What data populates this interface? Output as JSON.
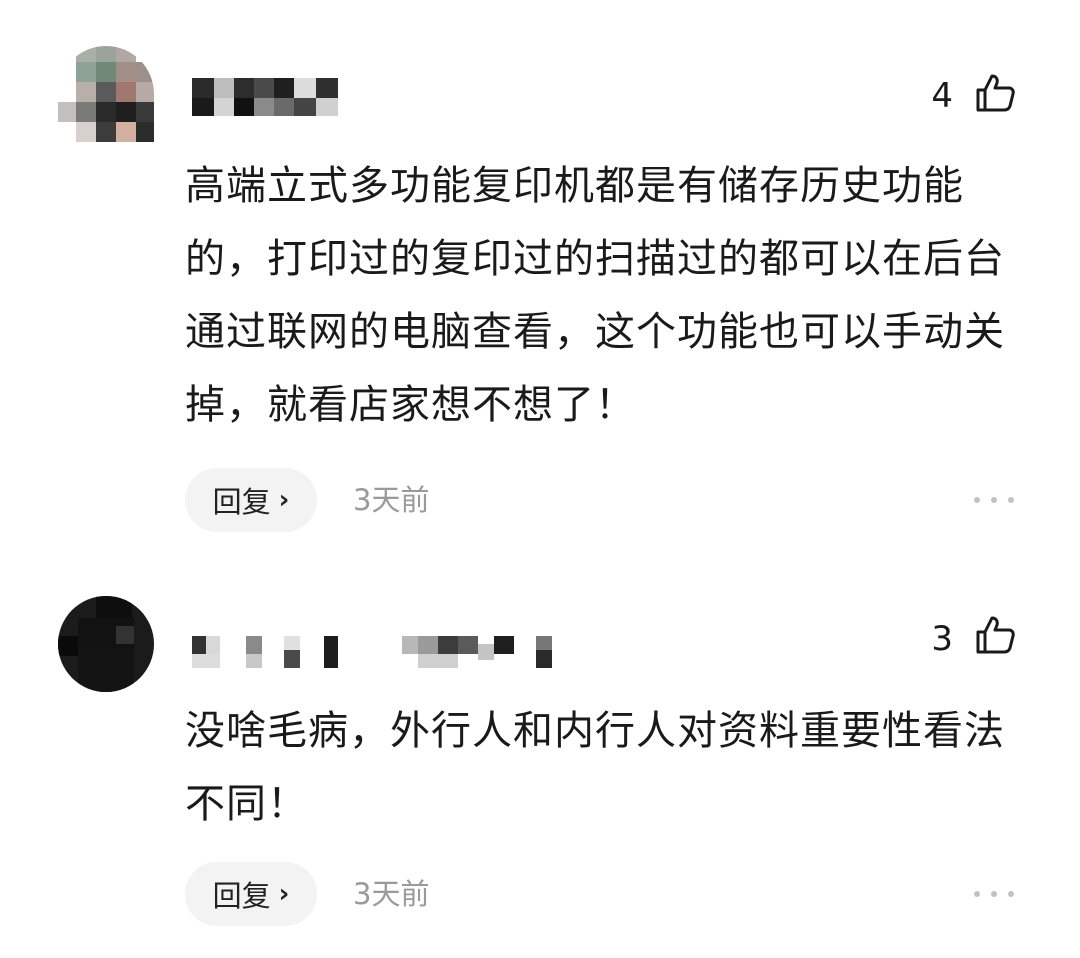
{
  "comments": [
    {
      "likes": "4",
      "content": "高端立式多功能复印机都是有储存历史功能的，打印过的复印过的扫描过的都可以在后台通过联网的电脑查看，这个功能也可以手动关掉，就看店家想不想了！",
      "reply_label": "回复",
      "time": "3天前"
    },
    {
      "likes": "3",
      "content": "没啥毛病，外行人和内行人对资料重要性看法不同！",
      "reply_label": "回复",
      "time": "3天前"
    }
  ],
  "icons": {
    "like": "thumbs-up-icon",
    "more": "more-dots-icon",
    "chevron": "chevron-right-icon"
  },
  "colors": {
    "text": "#1a1a1a",
    "muted": "#9a9a9a",
    "button_bg": "#f3f3f3"
  }
}
